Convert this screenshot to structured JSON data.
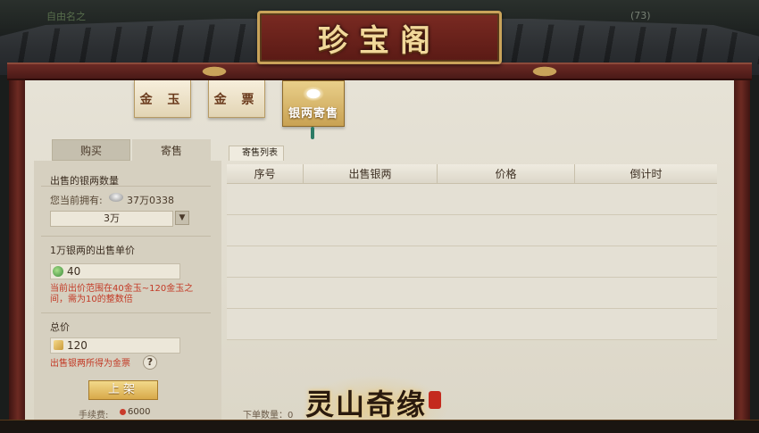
{
  "background": {
    "top_left_text": "自由名之",
    "top_right_text": "(73)"
  },
  "window": {
    "title": "珍宝阁"
  },
  "top_tabs": [
    {
      "label": "金 玉",
      "active": false
    },
    {
      "label": "金 票",
      "active": false
    },
    {
      "label": "银两寄售",
      "active": true
    }
  ],
  "left": {
    "sub_tabs": [
      {
        "label": "购买",
        "active": false
      },
      {
        "label": "寄售",
        "active": true
      }
    ],
    "amount_title": "出售的银两数量",
    "own_label": "您当前拥有:",
    "own_value": "37万0338",
    "amount_selected": "3万",
    "price_title": "1万银两的出售单价",
    "price_value": "40",
    "price_warning": "当前出价范围在40金玉~120金玉之间，需为10的整数倍",
    "total_title": "总价",
    "total_value": "120",
    "total_note": "出售银两所得为金票",
    "help_symbol": "?",
    "list_button": "上架",
    "fee_label": "手续费:",
    "fee_value": "6000"
  },
  "right": {
    "list_tab": "寄售列表",
    "columns": [
      "序号",
      "出售银两",
      "价格",
      "倒计时"
    ],
    "rows": [],
    "footer_label": "下单数量：0"
  },
  "logo": {
    "text": "灵山奇缘"
  },
  "colors": {
    "accent_gold": "#c9a35a",
    "warning_red": "#c33a26",
    "beam_red": "#6b2a24"
  }
}
